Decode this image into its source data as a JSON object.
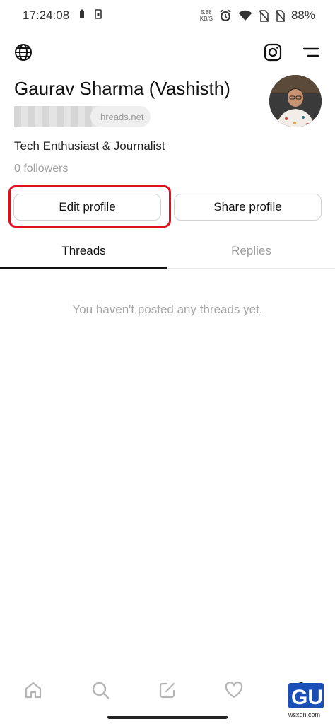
{
  "status_bar": {
    "time": "17:24:08",
    "net_speed_value": "5.88",
    "net_speed_unit": "KB/S",
    "battery_percent": "88%"
  },
  "profile": {
    "name": "Gaurav Sharma (Vashisth)",
    "handle_domain": "hreads.net",
    "bio": "Tech Enthusiast & Journalist",
    "followers": "0 followers"
  },
  "actions": {
    "edit_profile": "Edit profile",
    "share_profile": "Share profile"
  },
  "tabs": [
    {
      "label": "Threads",
      "active": true
    },
    {
      "label": "Replies",
      "active": false
    }
  ],
  "content": {
    "empty_message": "You haven't posted any threads yet."
  },
  "bottom_nav": [
    "home-icon",
    "search-icon",
    "compose-icon",
    "heart-icon",
    "profile-icon"
  ],
  "watermark": {
    "text": "wsxdn.com",
    "logo_text": "GU"
  },
  "colors": {
    "highlight": "#e0101a",
    "watermark_blue": "#1a4fb8"
  }
}
